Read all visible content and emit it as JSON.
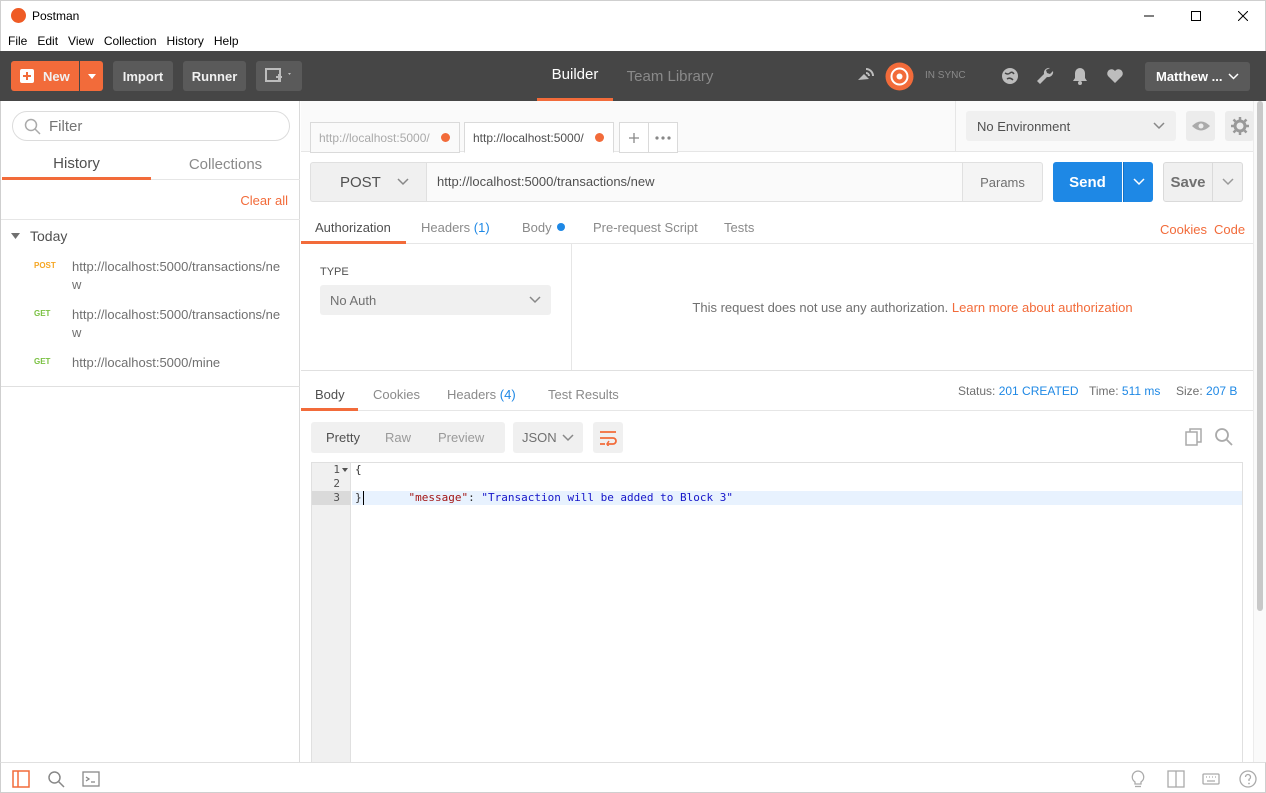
{
  "window": {
    "title": "Postman"
  },
  "menu": {
    "items": [
      "File",
      "Edit",
      "View",
      "Collection",
      "History",
      "Help"
    ]
  },
  "header": {
    "new_label": "New",
    "import_label": "Import",
    "runner_label": "Runner",
    "tabs": [
      "Builder",
      "Team Library"
    ],
    "sync_label": "IN SYNC",
    "user_label": "Matthew ..."
  },
  "sidebar": {
    "filter_placeholder": "Filter",
    "tabs": [
      "History",
      "Collections"
    ],
    "clear_all": "Clear all",
    "group_label": "Today",
    "items": [
      {
        "method": "POST",
        "url": "http://localhost:5000/transactions/new"
      },
      {
        "method": "GET",
        "url": "http://localhost:5000/transactions/new"
      },
      {
        "method": "GET",
        "url": "http://localhost:5000/mine"
      }
    ]
  },
  "request_tabs": [
    {
      "label": "http://localhost:5000/"
    },
    {
      "label": "http://localhost:5000/"
    }
  ],
  "environment": {
    "selected": "No Environment"
  },
  "request": {
    "method": "POST",
    "url": "http://localhost:5000/transactions/new",
    "params_label": "Params",
    "send_label": "Send",
    "save_label": "Save",
    "tabs": {
      "authorization": "Authorization",
      "headers": "Headers",
      "headers_count": "(1)",
      "body": "Body",
      "prerequest": "Pre-request Script",
      "tests": "Tests"
    },
    "cookies_link": "Cookies",
    "code_link": "Code",
    "auth": {
      "type_label": "TYPE",
      "type_value": "No Auth",
      "message": "This request does not use any authorization.",
      "learn_more": "Learn more about authorization"
    }
  },
  "response": {
    "tabs": {
      "body": "Body",
      "cookies": "Cookies",
      "headers": "Headers",
      "headers_count": "(4)",
      "test_results": "Test Results"
    },
    "status_label": "Status:",
    "status_value": "201 CREATED",
    "time_label": "Time:",
    "time_value": "511 ms",
    "size_label": "Size:",
    "size_value": "207 B",
    "view_modes": [
      "Pretty",
      "Raw",
      "Preview"
    ],
    "language": "JSON",
    "code": {
      "line_numbers": [
        "1",
        "2",
        "3"
      ],
      "open_brace": "{",
      "key": "\"message\"",
      "colon": ": ",
      "value": "\"Transaction will be added to Block 3\"",
      "close_brace": "}"
    }
  },
  "colors": {
    "accent": "#f26b3a",
    "primary_blue": "#1e88e5",
    "header_bg": "#464646"
  }
}
